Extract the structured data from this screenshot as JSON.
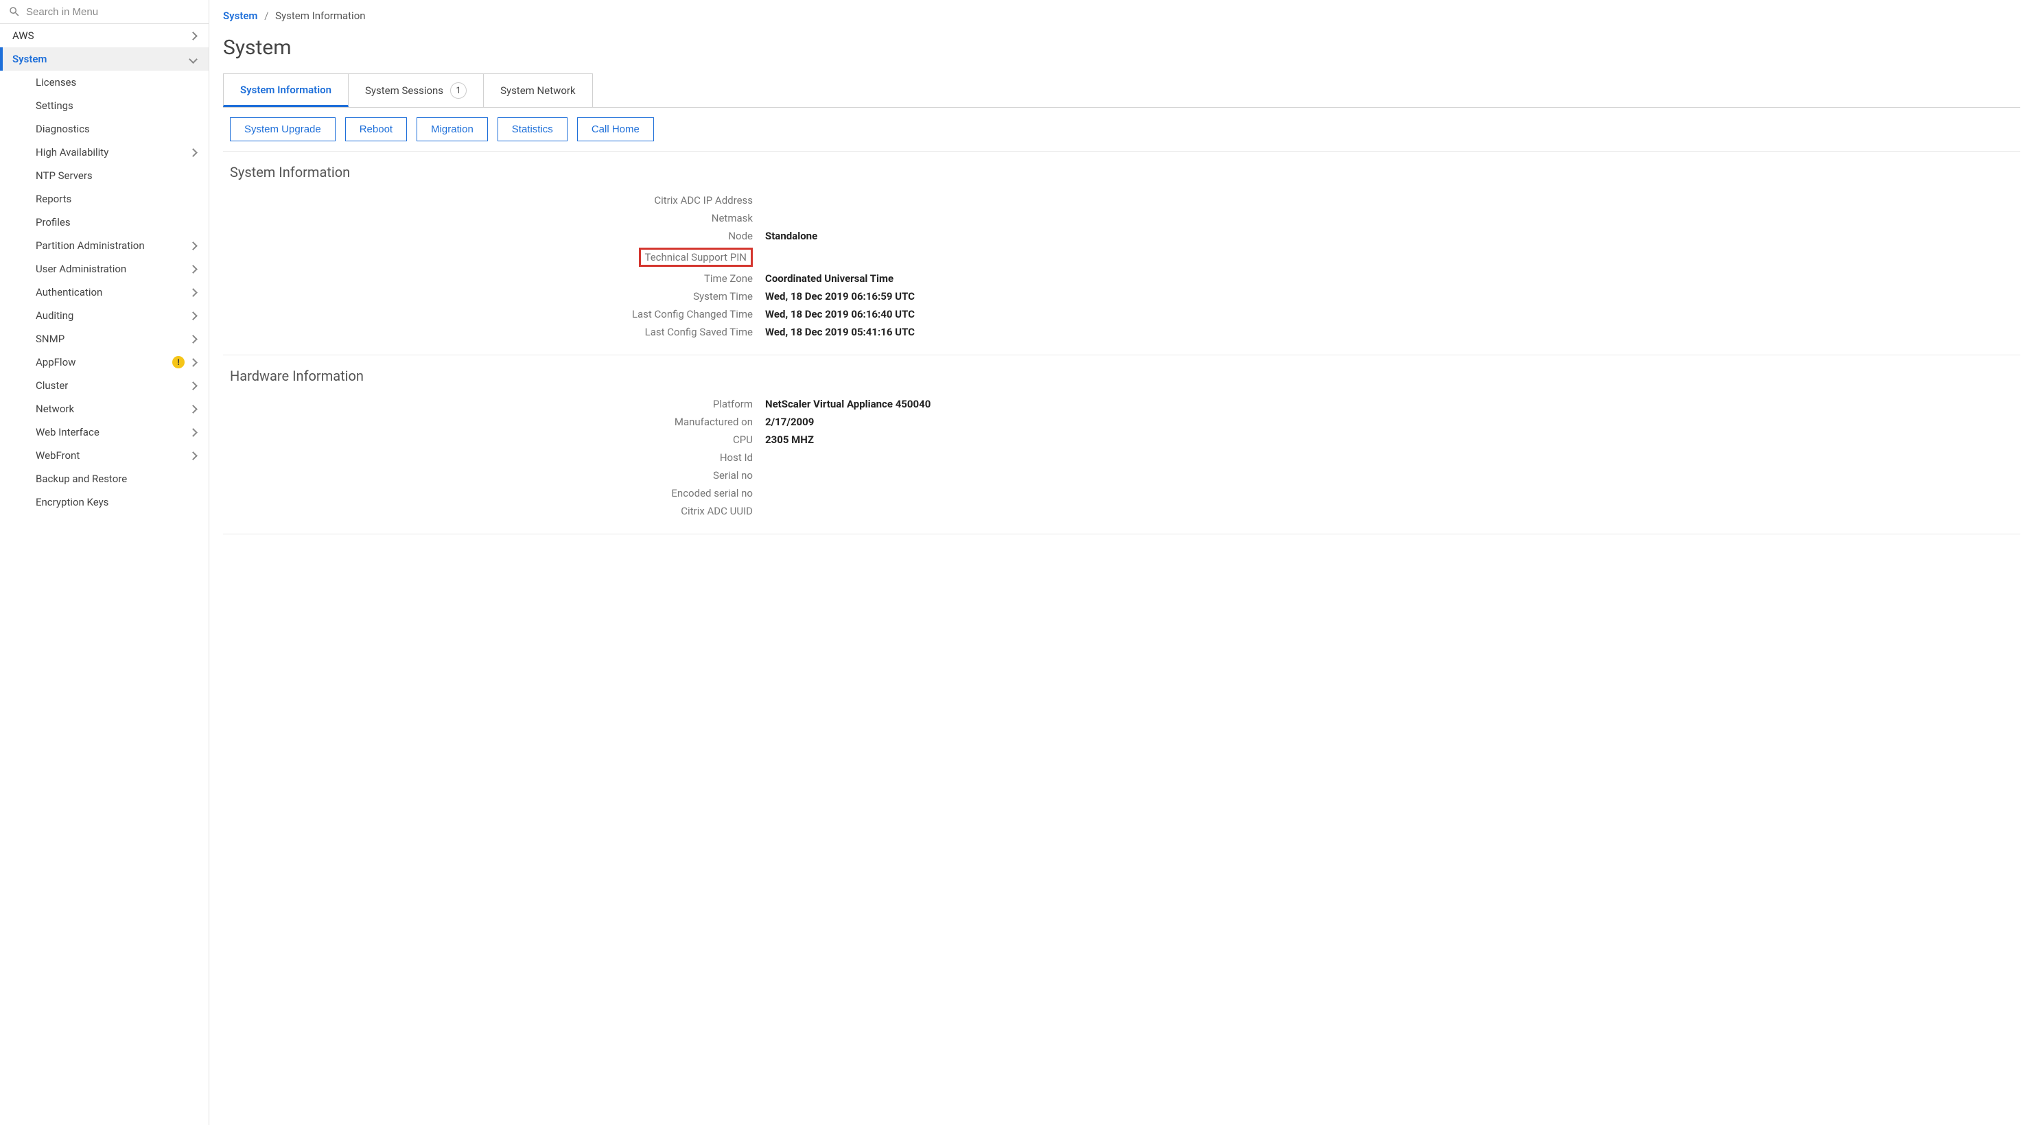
{
  "search": {
    "placeholder": "Search in Menu"
  },
  "sidebar": {
    "items": [
      {
        "label": "AWS",
        "expandable": true,
        "expanded": false,
        "active": false,
        "sub": false,
        "warn": false
      },
      {
        "label": "System",
        "expandable": true,
        "expanded": true,
        "active": true,
        "sub": false,
        "warn": false
      },
      {
        "label": "Licenses",
        "expandable": false,
        "expanded": false,
        "active": false,
        "sub": true,
        "warn": false
      },
      {
        "label": "Settings",
        "expandable": false,
        "expanded": false,
        "active": false,
        "sub": true,
        "warn": false
      },
      {
        "label": "Diagnostics",
        "expandable": false,
        "expanded": false,
        "active": false,
        "sub": true,
        "warn": false
      },
      {
        "label": "High Availability",
        "expandable": true,
        "expanded": false,
        "active": false,
        "sub": true,
        "warn": false
      },
      {
        "label": "NTP Servers",
        "expandable": false,
        "expanded": false,
        "active": false,
        "sub": true,
        "warn": false
      },
      {
        "label": "Reports",
        "expandable": false,
        "expanded": false,
        "active": false,
        "sub": true,
        "warn": false
      },
      {
        "label": "Profiles",
        "expandable": false,
        "expanded": false,
        "active": false,
        "sub": true,
        "warn": false
      },
      {
        "label": "Partition Administration",
        "expandable": true,
        "expanded": false,
        "active": false,
        "sub": true,
        "warn": false
      },
      {
        "label": "User Administration",
        "expandable": true,
        "expanded": false,
        "active": false,
        "sub": true,
        "warn": false
      },
      {
        "label": "Authentication",
        "expandable": true,
        "expanded": false,
        "active": false,
        "sub": true,
        "warn": false
      },
      {
        "label": "Auditing",
        "expandable": true,
        "expanded": false,
        "active": false,
        "sub": true,
        "warn": false
      },
      {
        "label": "SNMP",
        "expandable": true,
        "expanded": false,
        "active": false,
        "sub": true,
        "warn": false
      },
      {
        "label": "AppFlow",
        "expandable": true,
        "expanded": false,
        "active": false,
        "sub": true,
        "warn": true
      },
      {
        "label": "Cluster",
        "expandable": true,
        "expanded": false,
        "active": false,
        "sub": true,
        "warn": false
      },
      {
        "label": "Network",
        "expandable": true,
        "expanded": false,
        "active": false,
        "sub": true,
        "warn": false
      },
      {
        "label": "Web Interface",
        "expandable": true,
        "expanded": false,
        "active": false,
        "sub": true,
        "warn": false
      },
      {
        "label": "WebFront",
        "expandable": true,
        "expanded": false,
        "active": false,
        "sub": true,
        "warn": false
      },
      {
        "label": "Backup and Restore",
        "expandable": false,
        "expanded": false,
        "active": false,
        "sub": true,
        "warn": false
      },
      {
        "label": "Encryption Keys",
        "expandable": false,
        "expanded": false,
        "active": false,
        "sub": true,
        "warn": false
      }
    ]
  },
  "breadcrumb": {
    "root": "System",
    "current": "System Information"
  },
  "page_title": "System",
  "tabs": [
    {
      "label": "System Information",
      "count": null,
      "active": true
    },
    {
      "label": "System Sessions",
      "count": "1",
      "active": false
    },
    {
      "label": "System Network",
      "count": null,
      "active": false
    }
  ],
  "actions": [
    {
      "label": "System Upgrade"
    },
    {
      "label": "Reboot"
    },
    {
      "label": "Migration"
    },
    {
      "label": "Statistics"
    },
    {
      "label": "Call Home"
    }
  ],
  "panels": {
    "system_info": {
      "title": "System Information",
      "rows": [
        {
          "label": "Citrix ADC IP Address",
          "value": "",
          "highlight": false
        },
        {
          "label": "Netmask",
          "value": "",
          "highlight": false
        },
        {
          "label": "Node",
          "value": "Standalone",
          "highlight": false
        },
        {
          "label": "Technical Support PIN",
          "value": "",
          "highlight": true
        },
        {
          "label": "Time Zone",
          "value": "Coordinated Universal Time",
          "highlight": false
        },
        {
          "label": "System Time",
          "value": "Wed, 18 Dec 2019 06:16:59 UTC",
          "highlight": false
        },
        {
          "label": "Last Config Changed Time",
          "value": "Wed, 18 Dec 2019 06:16:40 UTC",
          "highlight": false
        },
        {
          "label": "Last Config Saved Time",
          "value": "Wed, 18 Dec 2019 05:41:16 UTC",
          "highlight": false
        }
      ]
    },
    "hardware_info": {
      "title": "Hardware Information",
      "rows": [
        {
          "label": "Platform",
          "value": "NetScaler Virtual Appliance 450040",
          "highlight": false
        },
        {
          "label": "Manufactured on",
          "value": "2/17/2009",
          "highlight": false
        },
        {
          "label": "CPU",
          "value": "2305 MHZ",
          "highlight": false
        },
        {
          "label": "Host Id",
          "value": "",
          "highlight": false
        },
        {
          "label": "Serial no",
          "value": "",
          "highlight": false
        },
        {
          "label": "Encoded serial no",
          "value": "",
          "highlight": false
        },
        {
          "label": "Citrix ADC UUID",
          "value": "",
          "highlight": false
        }
      ]
    }
  }
}
